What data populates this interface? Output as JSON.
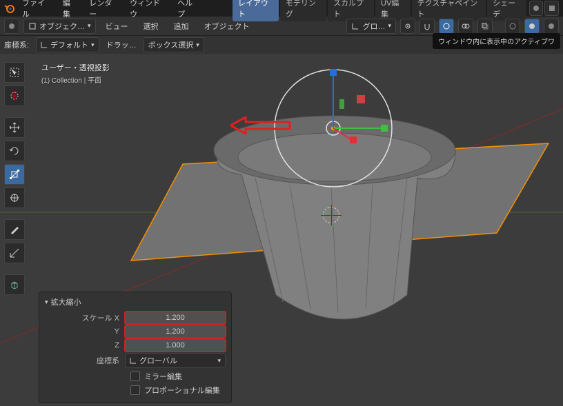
{
  "topmenu": {
    "file": "ファイル",
    "edit": "編集",
    "render": "レンダー",
    "window": "ウィンドウ",
    "help": "ヘルプ"
  },
  "workspace": {
    "layout": "レイアウト",
    "modeling": "モデリング",
    "sculpt": "スカルプト",
    "uv": "UV編集",
    "texpaint": "テクスチャペイント",
    "shade": "シェーデ"
  },
  "hdr2": {
    "mode": "オブジェク…",
    "view": "ビュー",
    "select": "選択",
    "add": "追加",
    "object": "オブジェクト",
    "orient": "グロ…"
  },
  "hdr3": {
    "coord": "座標系:",
    "default": "デフォルト",
    "drag": "ドラッ…",
    "boxselect": "ボックス選択"
  },
  "tooltip": "ウィンドウ内に表示中のアクティブワ",
  "overlay": {
    "line1": "ユーザー・透視投影",
    "line2": "(1) Collection | 平面"
  },
  "panel": {
    "title": "拡大縮小",
    "scalex_label": "スケール X",
    "scalex": "1.200",
    "scaley_label": "Y",
    "scaley": "1.200",
    "scalez_label": "Z",
    "scalez": "1.000",
    "orient_label": "座標系",
    "orient": "グローバル",
    "mirror": "ミラー編集",
    "prop": "プロポーショナル編集"
  }
}
